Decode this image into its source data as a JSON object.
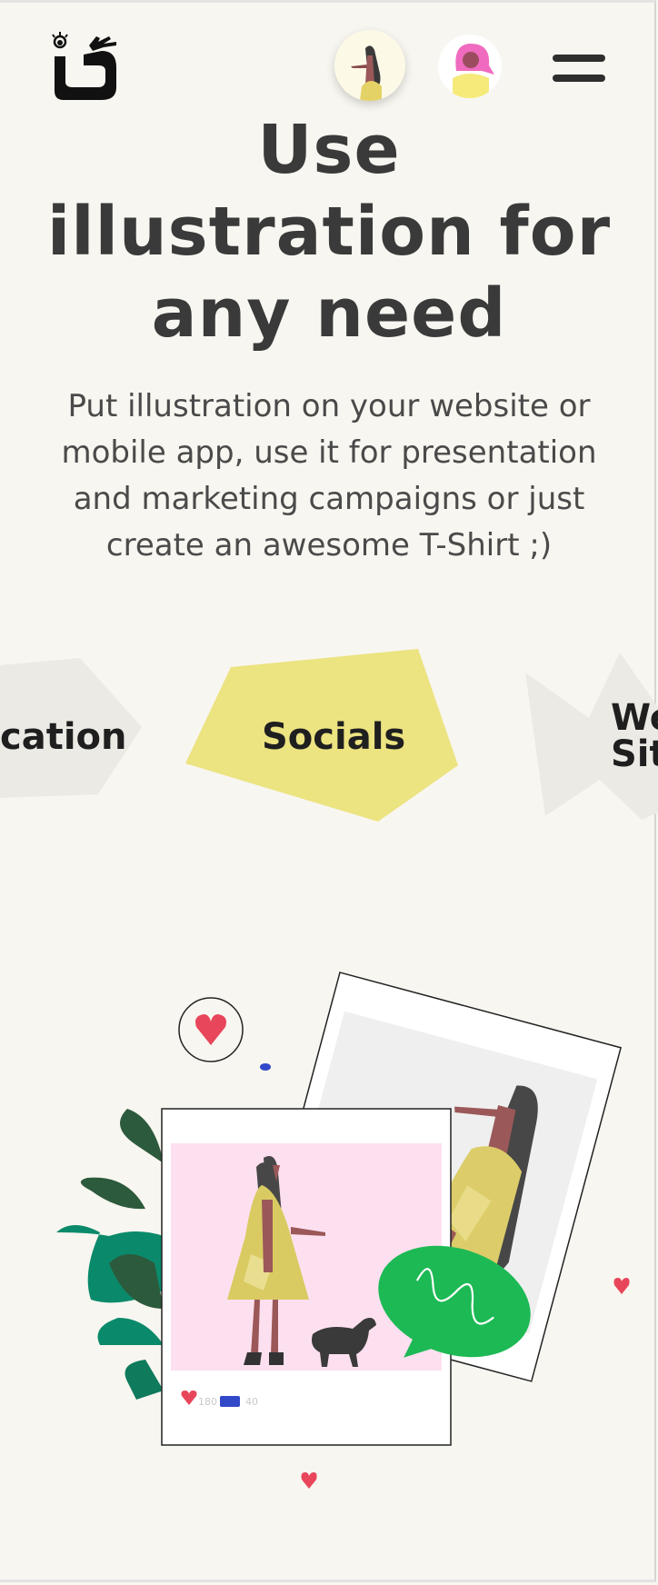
{
  "header": {
    "logo_icon": "eye-hand-logo-icon",
    "avatar_1_icon": "woman-avatar-icon",
    "avatar_2_icon": "pink-hair-avatar-icon",
    "menu_icon": "hamburger-menu-icon"
  },
  "hero": {
    "title_line_1": "Use",
    "title_line_2": "illustration for",
    "title_line_3": "any need",
    "subtitle_line_1": "Put illustration on your website or",
    "subtitle_line_2": "mobile app, use it for presentation",
    "subtitle_line_3": "and marketing campaigns or just",
    "subtitle_line_4": "create an awesome T-Shirt ;)"
  },
  "categories": {
    "left_label": "cation",
    "center_label": "Socials",
    "right_label_line_1": "We",
    "right_label_line_2": "Sit"
  },
  "post": {
    "likes": "180",
    "comments": "40"
  },
  "colors": {
    "background": "#f8f6f0",
    "accent_yellow": "#ece381",
    "shape_grey": "#ebeae5",
    "heart_red": "#e8465b",
    "speech_green": "#1db954",
    "plant_green": "#0a8a6b",
    "pink_card": "#fde0f0"
  }
}
